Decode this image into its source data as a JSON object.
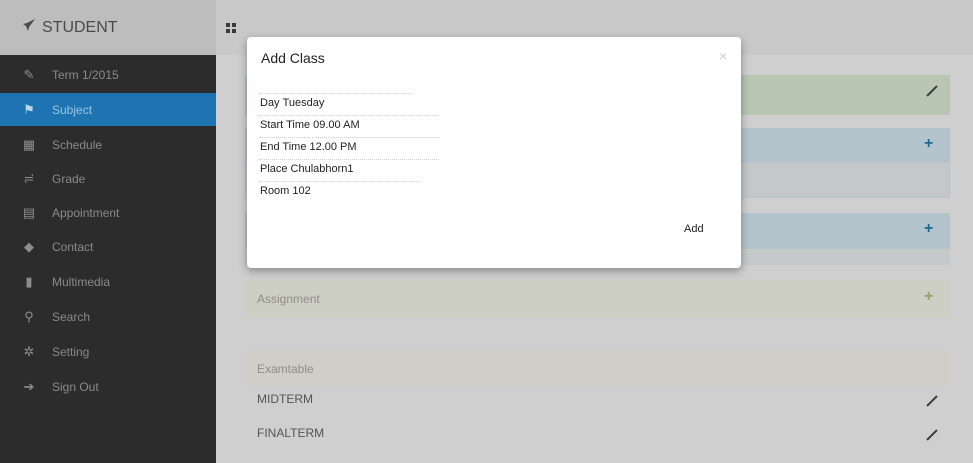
{
  "brand": {
    "icon": "rocket-icon",
    "title": "STUDENT"
  },
  "sidebar": {
    "items": [
      {
        "icon": "edit-icon",
        "label": "Term 1/2015",
        "active": false
      },
      {
        "icon": "flag-icon",
        "label": "Subject",
        "active": true
      },
      {
        "icon": "calendar-icon",
        "label": "Schedule",
        "active": false
      },
      {
        "icon": "road-icon",
        "label": "Grade",
        "active": false
      },
      {
        "icon": "list-icon",
        "label": "Appointment",
        "active": false
      },
      {
        "icon": "tag-icon",
        "label": "Contact",
        "active": false
      },
      {
        "icon": "file-icon",
        "label": "Multimedia",
        "active": false
      },
      {
        "icon": "search-icon",
        "label": "Search",
        "active": false
      },
      {
        "icon": "cog-icon",
        "label": "Setting",
        "active": false
      },
      {
        "icon": "sign-out-icon",
        "label": "Sign Out",
        "active": false
      }
    ]
  },
  "main": {
    "assignment_label": "Assignment",
    "examtable_label": "Examtable",
    "exams": [
      {
        "label": "MIDTERM"
      },
      {
        "label": "FINALTERM"
      }
    ]
  },
  "modal": {
    "title": "Add Class",
    "close": "×",
    "fields": [
      {
        "label": "Day",
        "value": "Tuesday"
      },
      {
        "label": "Start Time",
        "value": "09.00 AM"
      },
      {
        "label": "End Time",
        "value": "12.00 PM"
      },
      {
        "label": "Place",
        "value": "Chulabhorn1"
      },
      {
        "label": "Room",
        "value": "102"
      }
    ],
    "add_label": "Add"
  },
  "colors": {
    "sidebar_bg": "#2c2c2c",
    "active_item": "#1d74b1",
    "panel_green": "#b8c6b3",
    "panel_blue": "#b3c4cd",
    "action_blue": "#1f6a8f",
    "action_olive": "#9aa06a"
  }
}
